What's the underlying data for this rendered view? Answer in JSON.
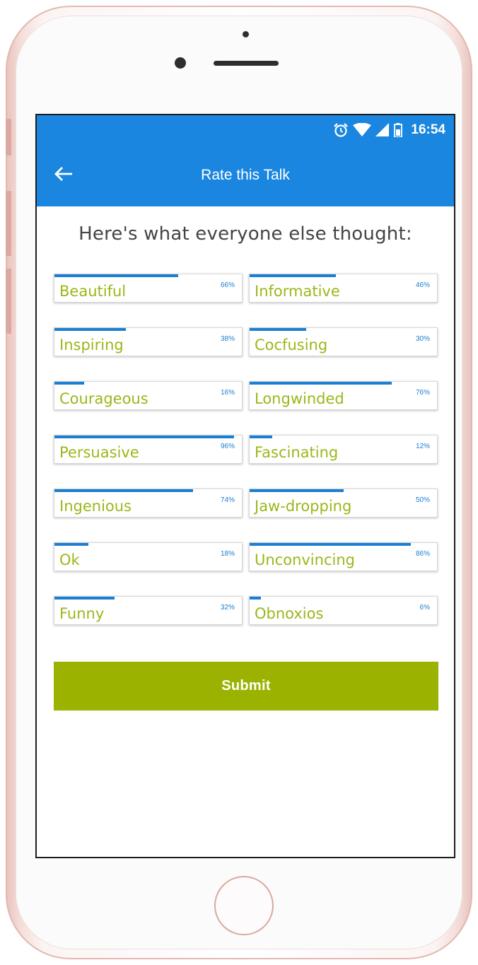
{
  "status_bar": {
    "time": "16:54",
    "icons": [
      "alarm-icon",
      "wifi-icon",
      "signal-icon",
      "battery-icon"
    ]
  },
  "app_bar": {
    "title": "Rate this Talk",
    "back_icon": "arrow-left-icon"
  },
  "heading": "Here's what everyone else thought:",
  "ratings": [
    {
      "label": "Beautiful",
      "percent_text": "66%",
      "percent": 66
    },
    {
      "label": "Informative",
      "percent_text": "46%",
      "percent": 46
    },
    {
      "label": "Inspiring",
      "percent_text": "38%",
      "percent": 38
    },
    {
      "label": "Cocfusing",
      "percent_text": "30%",
      "percent": 30
    },
    {
      "label": "Courageous",
      "percent_text": "16%",
      "percent": 16
    },
    {
      "label": "Longwinded",
      "percent_text": "76%",
      "percent": 76
    },
    {
      "label": "Persuasive",
      "percent_text": "96%",
      "percent": 96
    },
    {
      "label": "Fascinating",
      "percent_text": "12%",
      "percent": 12
    },
    {
      "label": "Ingenious",
      "percent_text": "74%",
      "percent": 74
    },
    {
      "label": "Jaw-dropping",
      "percent_text": "50%",
      "percent": 50
    },
    {
      "label": "Ok",
      "percent_text": "18%",
      "percent": 18
    },
    {
      "label": "Unconvincing",
      "percent_text": "86%",
      "percent": 86
    },
    {
      "label": "Funny",
      "percent_text": "32%",
      "percent": 32
    },
    {
      "label": "Obnoxios",
      "percent_text": "6%",
      "percent": 6
    }
  ],
  "submit_label": "Submit",
  "colors": {
    "primary": "#1a86e0",
    "bar": "#1a7fd2",
    "label_green": "#99b81a",
    "submit": "#9bb300",
    "phone_rose": "#e8c3bd"
  }
}
